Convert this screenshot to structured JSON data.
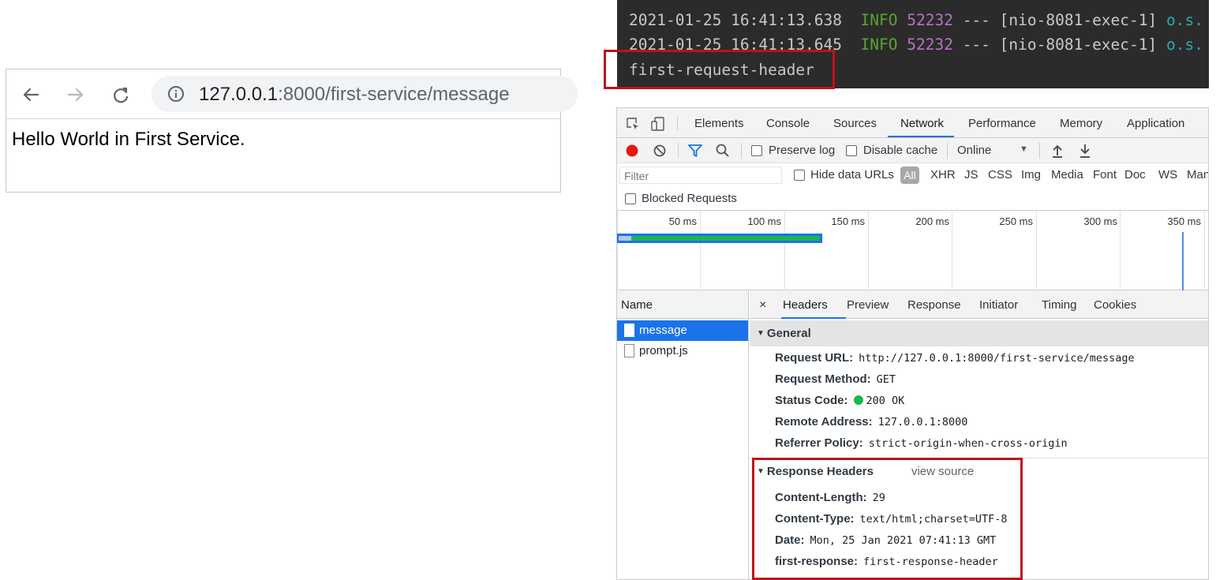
{
  "browser": {
    "url_host": "127.0.0.1",
    "url_rest": ":8000/first-service/message",
    "page_text": "Hello World in First Service."
  },
  "terminal": {
    "lines": [
      {
        "timestamp": "2021-01-25 16:41:13.638",
        "level": "INFO",
        "pid": "52232",
        "sep": "---",
        "thread": "[nio-8081-exec-1]",
        "logger": "o.s."
      },
      {
        "timestamp": "2021-01-25 16:41:13.645",
        "level": "INFO",
        "pid": "52232",
        "sep": "---",
        "thread": "[nio-8081-exec-1]",
        "logger": "o.s."
      }
    ],
    "highlighted": "first-request-header"
  },
  "devtools": {
    "tabs": [
      "Elements",
      "Console",
      "Sources",
      "Network",
      "Performance",
      "Memory",
      "Application"
    ],
    "active_tab": "Network",
    "toolbar": {
      "preserve_log": "Preserve log",
      "disable_cache": "Disable cache",
      "throttling": "Online"
    },
    "filter_bar": {
      "placeholder": "Filter",
      "hide_data_urls": "Hide data URLs",
      "types": [
        "All",
        "XHR",
        "JS",
        "CSS",
        "Img",
        "Media",
        "Font",
        "Doc",
        "WS",
        "Man"
      ]
    },
    "blocked_requests": "Blocked Requests",
    "timeline_ticks": [
      "50 ms",
      "100 ms",
      "150 ms",
      "200 ms",
      "250 ms",
      "300 ms",
      "350 ms"
    ],
    "name_header": "Name",
    "requests": [
      "message",
      "prompt.js"
    ],
    "selected_request": "message",
    "detail_close": "×",
    "detail_tabs": [
      "Headers",
      "Preview",
      "Response",
      "Initiator",
      "Timing",
      "Cookies"
    ],
    "active_detail_tab": "Headers",
    "general": {
      "title": "General",
      "rows": [
        {
          "key": "Request URL:",
          "value": "http://127.0.0.1:8000/first-service/message"
        },
        {
          "key": "Request Method:",
          "value": "GET"
        },
        {
          "key": "Status Code:",
          "value": "200 OK"
        },
        {
          "key": "Remote Address:",
          "value": "127.0.0.1:8000"
        },
        {
          "key": "Referrer Policy:",
          "value": "strict-origin-when-cross-origin"
        }
      ]
    },
    "response_headers": {
      "title": "Response Headers",
      "view_source": "view source",
      "rows": [
        {
          "key": "Content-Length:",
          "value": "29"
        },
        {
          "key": "Content-Type:",
          "value": "text/html;charset=UTF-8"
        },
        {
          "key": "Date:",
          "value": "Mon, 25 Jan 2021 07:41:13 GMT"
        },
        {
          "key": "first-response:",
          "value": "first-response-header"
        }
      ]
    }
  },
  "colors": {
    "highlight_box": "#c0101a",
    "network_accent": "#1a73e8",
    "status_ok": "#1bb551",
    "terminal_bg": "#2b2b2b"
  }
}
